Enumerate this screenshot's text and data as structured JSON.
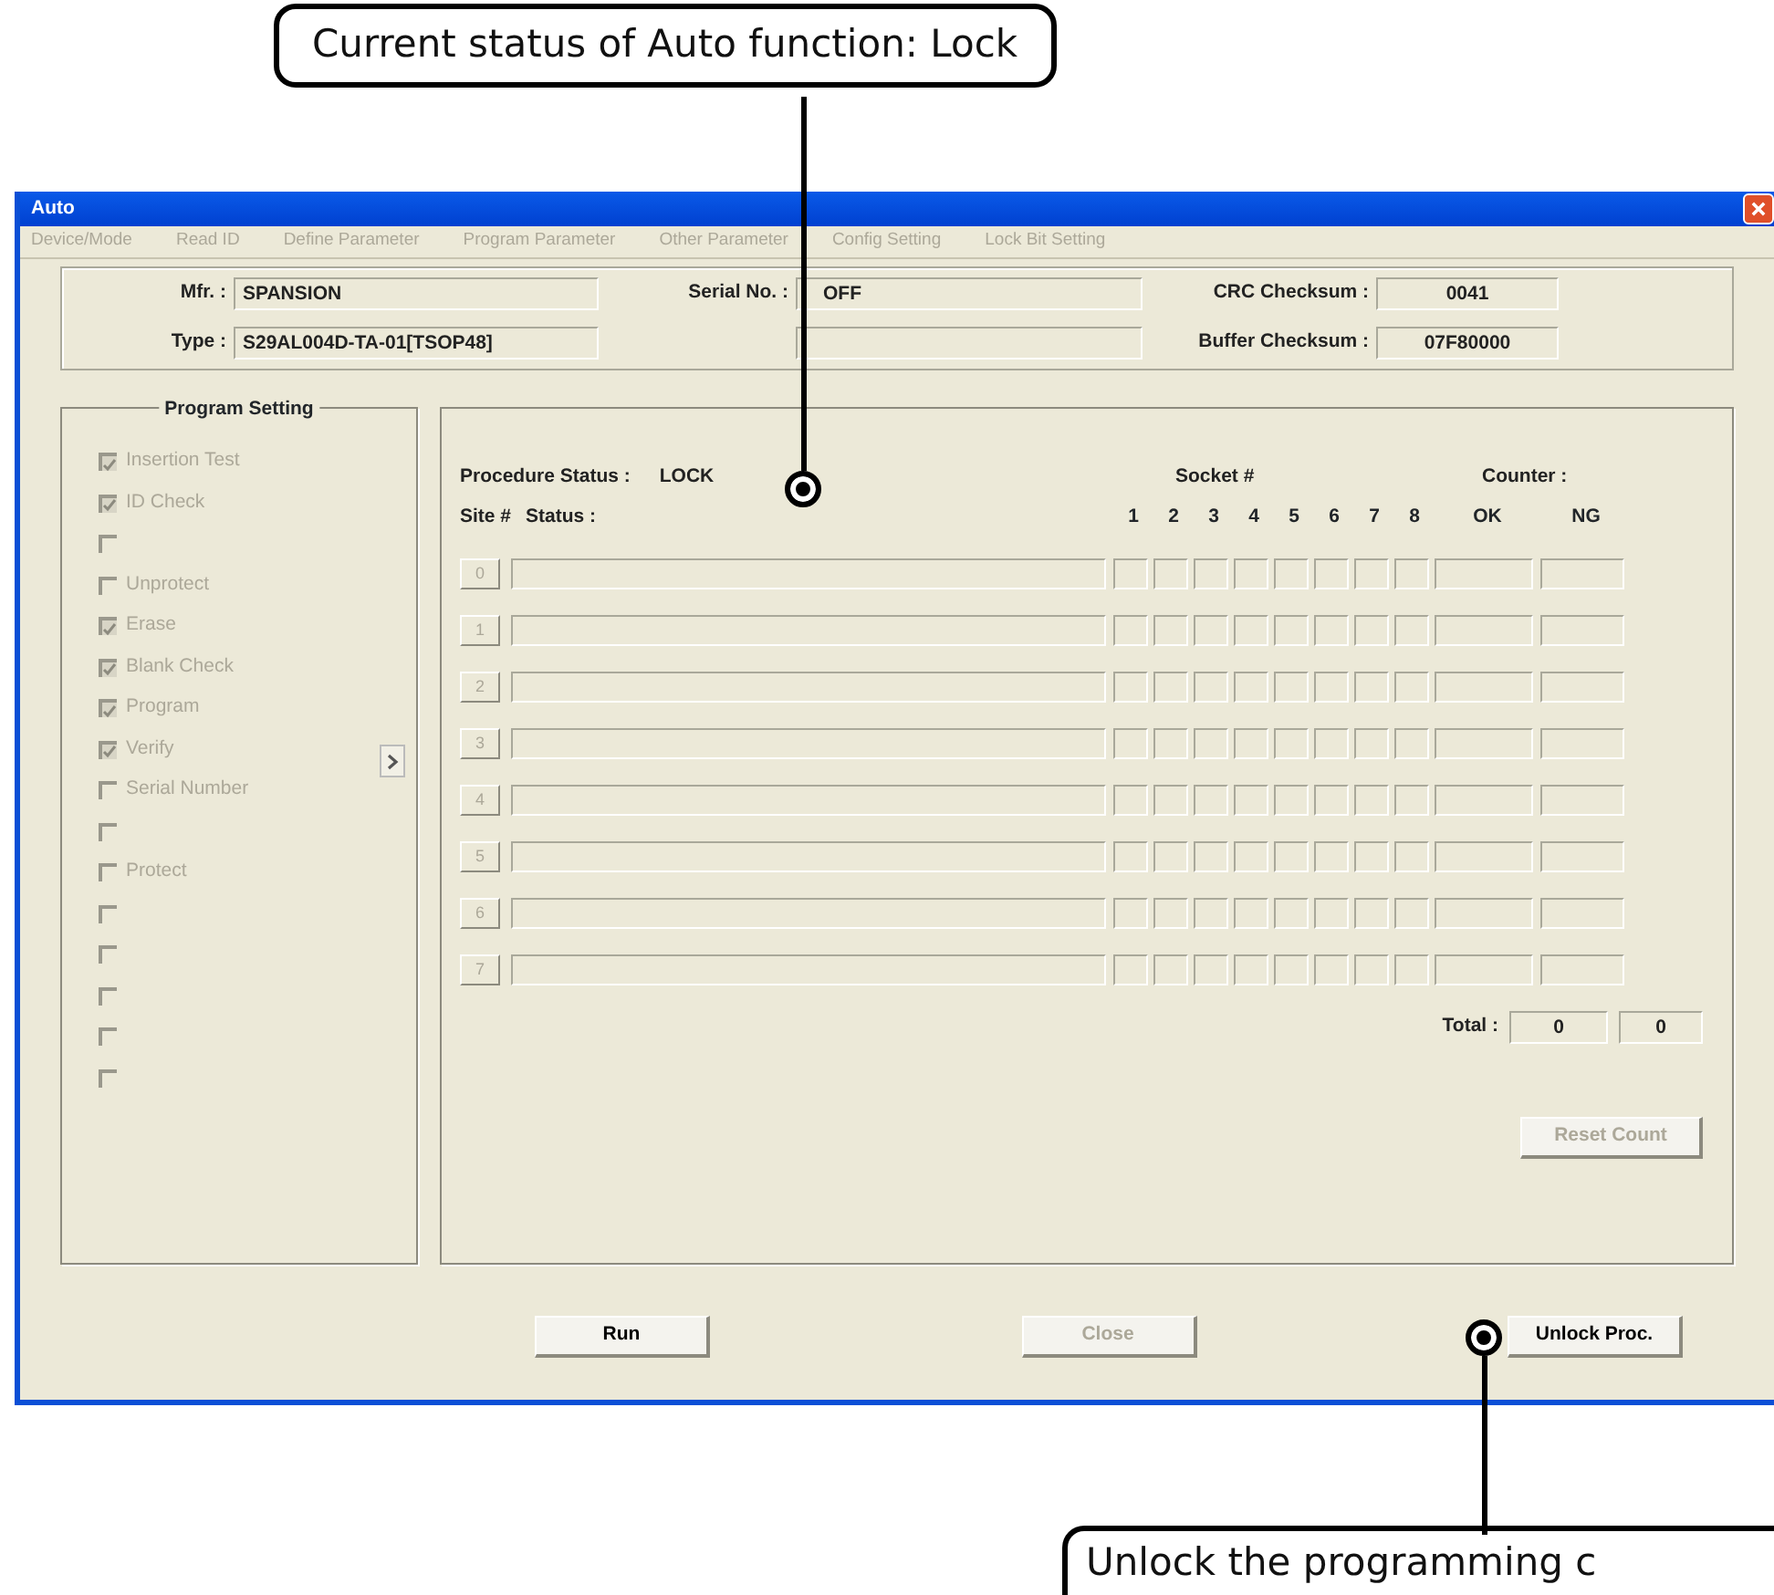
{
  "top_callout": {
    "text": "Current status of Auto function: Lock"
  },
  "window": {
    "title": "Auto"
  },
  "menu": [
    {
      "label": "Device/Mode",
      "disabled": true
    },
    {
      "label": "Read ID",
      "disabled": true
    },
    {
      "label": "Define Parameter",
      "disabled": true
    },
    {
      "label": "Program Parameter",
      "disabled": true
    },
    {
      "label": "Other Parameter",
      "disabled": true
    },
    {
      "label": "Config Setting",
      "disabled": true
    },
    {
      "label": "Lock Bit Setting",
      "disabled": true
    }
  ],
  "info": {
    "mfr_label": "Mfr. :",
    "mfr": "SPANSION",
    "type_label": "Type :",
    "type": "S29AL004D-TA-01[TSOP48]",
    "serial_label": "Serial No. :",
    "serial": "OFF",
    "crc_label": "CRC Checksum :",
    "crc": "0041",
    "buffer_label": "Buffer Checksum :",
    "buffer": "07F80000"
  },
  "program_setting": {
    "title": "Program Setting",
    "items": [
      {
        "label": "Insertion Test",
        "checked": true,
        "disabled": true
      },
      {
        "label": "ID Check",
        "checked": true,
        "disabled": true
      },
      {
        "checked": false,
        "disabled": true
      },
      {
        "label": "Unprotect",
        "checked": false,
        "disabled": true
      },
      {
        "label": "Erase",
        "checked": true,
        "disabled": true
      },
      {
        "label": "Blank Check",
        "checked": true,
        "disabled": true
      },
      {
        "label": "Program",
        "checked": true,
        "disabled": true
      },
      {
        "label": "Verify",
        "checked": true,
        "disabled": true
      },
      {
        "label": "Serial Number",
        "checked": false,
        "disabled": true
      },
      {
        "checked": false,
        "disabled": true
      },
      {
        "label": "Protect",
        "checked": false,
        "disabled": true
      },
      {
        "checked": false,
        "disabled": true
      },
      {
        "checked": false,
        "disabled": true
      },
      {
        "checked": false,
        "disabled": true
      },
      {
        "checked": false,
        "disabled": true
      },
      {
        "checked": false,
        "disabled": true
      }
    ]
  },
  "procedure": {
    "status_label": "Procedure Status :",
    "status_value": "LOCK",
    "socket_label": "Socket #",
    "counter_label": "Counter :",
    "site_header": "Site #",
    "status_header": "Status :",
    "socket_numbers": [
      "1",
      "2",
      "3",
      "4",
      "5",
      "6",
      "7",
      "8"
    ],
    "ok_header": "OK",
    "ng_header": "NG",
    "sites": [
      {
        "label": "0",
        "disabled": true
      },
      {
        "label": "1",
        "disabled": true
      },
      {
        "label": "2",
        "disabled": true
      },
      {
        "label": "3",
        "disabled": true
      },
      {
        "label": "4",
        "disabled": true
      },
      {
        "label": "5",
        "disabled": true
      },
      {
        "label": "6",
        "disabled": true
      },
      {
        "label": "7",
        "disabled": true
      }
    ],
    "total_label": "Total :",
    "total_ok": "0",
    "total_ng": "0",
    "reset_button": {
      "label": "Reset Count",
      "disabled": true
    }
  },
  "buttons": [
    {
      "label": "Run",
      "disabled": false
    },
    {
      "label": "Close",
      "disabled": true
    },
    {
      "label": "Unlock Proc.",
      "disabled": false
    }
  ],
  "bottom_callout": {
    "text": "Unlock the programming c"
  }
}
